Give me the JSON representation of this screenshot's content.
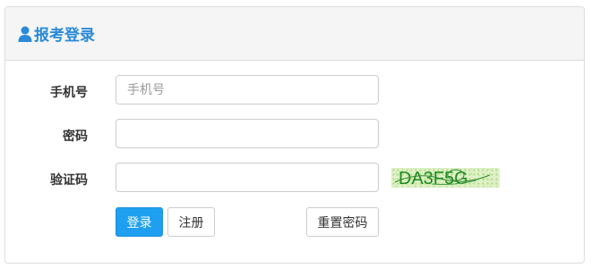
{
  "panel": {
    "title": "报考登录",
    "icon": "user-icon",
    "title_color": "#2a8ad7"
  },
  "form": {
    "phone": {
      "label": "手机号",
      "placeholder": "手机号",
      "value": ""
    },
    "password": {
      "label": "密码",
      "placeholder": "",
      "value": ""
    },
    "captcha": {
      "label": "验证码",
      "placeholder": "",
      "value": "",
      "image_text": "DA3F5G"
    }
  },
  "buttons": {
    "login": "登录",
    "register": "注册",
    "reset_password": "重置密码"
  },
  "colors": {
    "primary": "#1e9fef",
    "captcha_text": "#1f8a1f",
    "captcha_bg": "#dff1c8"
  }
}
